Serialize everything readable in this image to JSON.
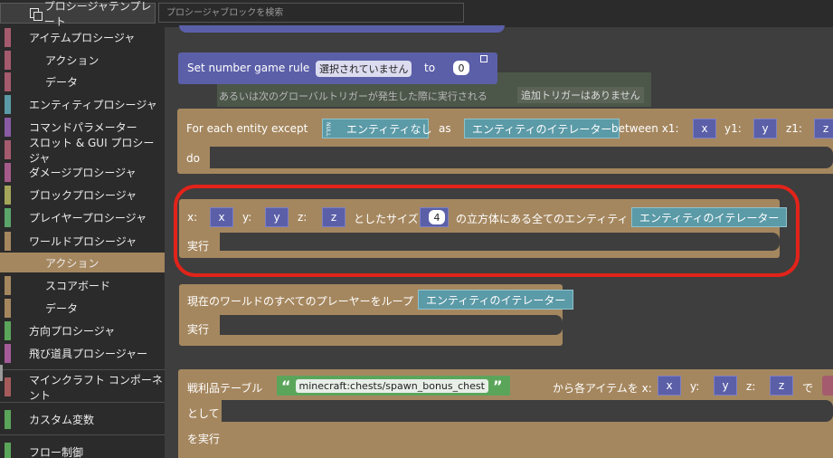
{
  "header": {
    "tab_label": "プロシージャテンプレート",
    "search_placeholder": "プロシージャブロックを検索"
  },
  "sidebar": {
    "items": [
      {
        "label": "アイテムプロシージャ",
        "color": "#a55b6e",
        "sub": false
      },
      {
        "label": "アクション",
        "color": "#a55b6e",
        "sub": true
      },
      {
        "label": "データ",
        "color": "#a55b6e",
        "sub": true
      },
      {
        "label": "エンティティプロシージャ",
        "color": "#5b9aa7",
        "sub": false
      },
      {
        "label": "コマンドパラメーター",
        "color": "#8a5ba5",
        "sub": false
      },
      {
        "label": "スロット & GUI プロシージャ",
        "color": "#a55b6e",
        "sub": false
      },
      {
        "label": "ダメージプロシージャ",
        "color": "#a55b8a",
        "sub": false
      },
      {
        "label": "ブロックプロシージャ",
        "color": "#a5a55b",
        "sub": false
      },
      {
        "label": "プレイヤープロシージャ",
        "color": "#5ba56b",
        "sub": false
      },
      {
        "label": "ワールドプロシージャ",
        "color": "#a5875f",
        "sub": false
      },
      {
        "label": "アクション",
        "color": "#a5875f",
        "sub": true,
        "selected": true
      },
      {
        "label": "スコアボード",
        "color": "#a5875f",
        "sub": true
      },
      {
        "label": "データ",
        "color": "#a5875f",
        "sub": true
      },
      {
        "label": "方向プロシージャ",
        "color": "#5ba55b",
        "sub": false
      },
      {
        "label": "飛び道具プロシージャー",
        "color": "#a55b9a",
        "sub": false
      },
      {
        "label": "マインクラフト コンポーネント",
        "color": "#a55b5b",
        "sub": false
      },
      {
        "label": "カスタム変数",
        "color": "#5ba55b",
        "sub": false
      },
      {
        "label": "フロー制御",
        "color": "#5ba55b",
        "sub": false
      }
    ]
  },
  "workspace": {
    "ghost_line1": "あるいは次のグローバルトリガーが発生した際に実行される",
    "ghost_line2": "追加トリガーはありません",
    "block_gamerule": {
      "text": "Set number game rule",
      "dropdown": "選択されていません",
      "to": "to",
      "value": "0"
    },
    "block_foreach_except": {
      "text": "For each entity except",
      "null": "NULL",
      "none": "エンティティなし",
      "as": "as",
      "iterator": "エンティティのイテレーター",
      "between": "between x1:",
      "y1": "y1:",
      "z1": "z1:",
      "do": "do",
      "x": "x",
      "y": "y",
      "z": "z"
    },
    "block_cube": {
      "x_label": "x:",
      "x": "x",
      "y_label": "y:",
      "y": "y",
      "z_label": "z:",
      "z": "z",
      "size_label": "としたサイズ",
      "size": "4",
      "suffix": "の立方体にある全てのエンティティ",
      "iterator": "エンティティのイテレーター",
      "exec": "実行"
    },
    "block_players": {
      "text": "現在のワールドのすべてのプレーヤーをループ",
      "iterator": "エンティティのイテレーター",
      "exec": "実行"
    },
    "block_loot": {
      "text": "戦利品テーブル",
      "table": "minecraft:chests/spawn_bonus_chest",
      "mid": "から各アイテムを x:",
      "x": "x",
      "y_label": "y:",
      "y": "y",
      "z_label": "z:",
      "z": "z",
      "de": "で",
      "as": "として",
      "exec": "を実行"
    }
  },
  "highlight_color": "#e2231a"
}
